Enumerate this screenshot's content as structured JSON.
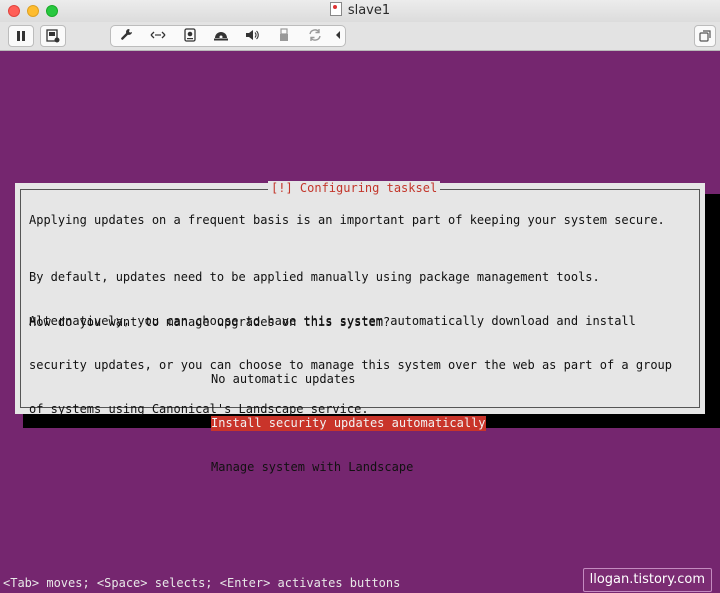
{
  "window": {
    "title": "slave1"
  },
  "toolbar": {
    "icons": [
      "pause-icon",
      "snapshot-icon",
      "wrench-icon",
      "network-icon",
      "hard-disk-icon",
      "cd-dvd-icon",
      "sound-icon",
      "usb-icon",
      "shared-folder-icon",
      "chevron-left-icon",
      "fullscreen-icon"
    ]
  },
  "dialog": {
    "title": "[!] Configuring tasksel",
    "intro": "Applying updates on a frequent basis is an important part of keeping your system secure.",
    "body_lines": [
      "By default, updates need to be applied manually using package management tools.",
      "Alternatively, you can choose to have this system automatically download and install",
      "security updates, or you can choose to manage this system over the web as part of a group",
      "of systems using Canonical's Landscape service."
    ],
    "question": "How do you want to manage upgrades on this system?",
    "options": [
      {
        "label": "No automatic updates",
        "selected": false
      },
      {
        "label": "Install security updates automatically",
        "selected": true
      },
      {
        "label": "Manage system with Landscape",
        "selected": false
      }
    ]
  },
  "status_line": "<Tab> moves; <Space> selects; <Enter> activates buttons",
  "watermark": "llogan.tistory.com",
  "colors": {
    "background": "#75266f",
    "dialog": "#e6e6e6",
    "accent": "#c9342a"
  }
}
